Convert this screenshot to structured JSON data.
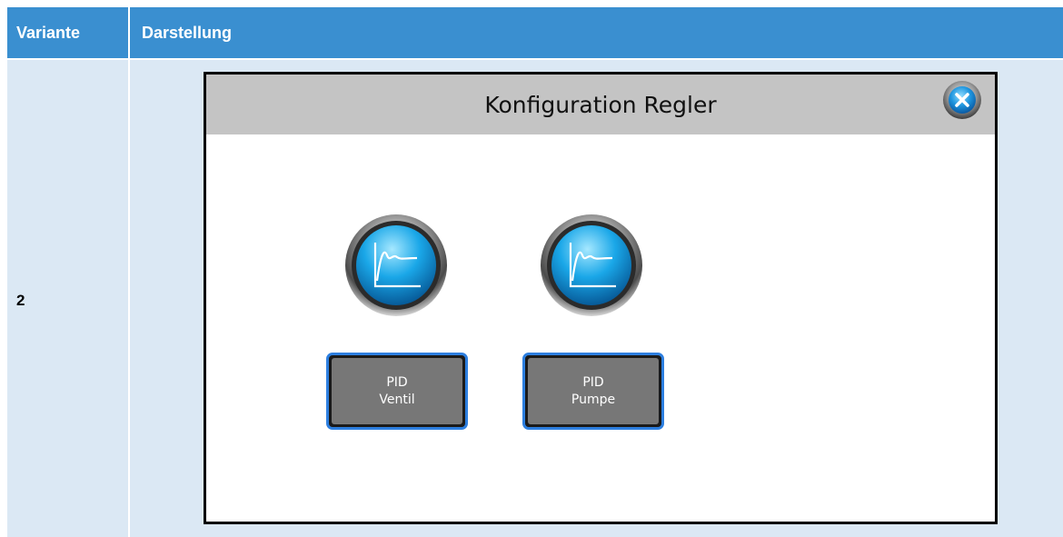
{
  "table": {
    "header": {
      "variant_label": "Variante",
      "display_label": "Darstellung"
    },
    "row": {
      "variant": "2"
    }
  },
  "hmi": {
    "title": "Konfiguration Regler",
    "close_icon": "close-icon",
    "controllers": [
      {
        "icon": "pid-response-curve-icon",
        "line1": "PID",
        "line2": "Ventil"
      },
      {
        "icon": "pid-response-curve-icon",
        "line1": "PID",
        "line2": "Pumpe"
      }
    ]
  },
  "colors": {
    "header_bg": "#3a8fd0",
    "cell_bg": "#dbe8f4",
    "title_bar_bg": "#c4c4c4",
    "button_border": "#2d7fe0",
    "button_face": "#777777",
    "icon_blue": "#1aa7e8"
  }
}
